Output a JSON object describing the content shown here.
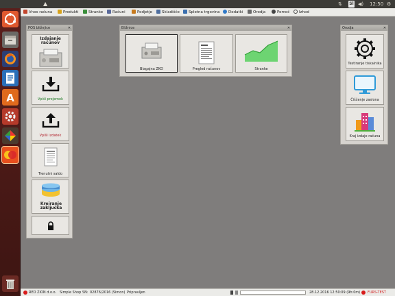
{
  "top_panel": {
    "keyboard_indicator": "Sl",
    "clock": "12:50"
  },
  "menu": [
    {
      "label": "Vnos računa",
      "icon": "receipt-icon",
      "color": "#c2452d"
    },
    {
      "label": "Produkti",
      "icon": "product-icon",
      "color": "#d7a21a"
    },
    {
      "label": "Stranke",
      "icon": "customers-icon",
      "color": "#3a8e3a"
    },
    {
      "label": "Računi",
      "icon": "invoices-icon",
      "color": "#5a6a9a"
    },
    {
      "label": "Podjetje",
      "icon": "company-icon",
      "color": "#c77a1d"
    },
    {
      "label": "Skladišče",
      "icon": "warehouse-icon",
      "color": "#4f6f9f"
    },
    {
      "label": "Spletna trgovina",
      "icon": "cart-icon",
      "color": "#3a6fae"
    },
    {
      "label": "Dodatki",
      "icon": "addons-icon",
      "color": "#2f79c8"
    },
    {
      "label": "Orodja",
      "icon": "tools-icon",
      "color": "#6a6a6a"
    },
    {
      "label": "Pomoč",
      "icon": "help-icon",
      "color": "#444444"
    },
    {
      "label": "Izhod",
      "icon": "exit-icon",
      "color": "#444444"
    }
  ],
  "pos_panel": {
    "title": "POS bližnjice",
    "buttons": [
      {
        "label": "Izdajanje računov",
        "icon": "cash-register-icon",
        "style": "bold"
      },
      {
        "label": "Vpiši prejemek",
        "icon": "download-tray-icon",
        "style": "grn"
      },
      {
        "label": "Vpiši izdatek",
        "icon": "upload-tray-icon",
        "style": "red"
      },
      {
        "label": "Trenutni saldo",
        "icon": "document-icon",
        "style": ""
      },
      {
        "label": "Kreiranje zaključka",
        "icon": "database-icon",
        "style": "bold"
      },
      {
        "label": "",
        "icon": "lock-icon",
        "style": ""
      }
    ]
  },
  "shortcuts_panel": {
    "title": "Bližnice",
    "buttons": [
      {
        "label": "Blagajna ZKD",
        "icon": "register-icon"
      },
      {
        "label": "Pregled računov",
        "icon": "invoice-list-icon"
      },
      {
        "label": "Stranke",
        "icon": "chart-area-icon"
      }
    ]
  },
  "tools_panel": {
    "title": "Orodja",
    "buttons": [
      {
        "label": "Testiranje tiskalnika",
        "icon": "gear-icon"
      },
      {
        "label": "Čiščenje zaslona",
        "icon": "monitor-icon"
      },
      {
        "label": "Kraj izdaje računa",
        "icon": "buildings-icon"
      }
    ]
  },
  "status": {
    "company": "RED ZION d.o.o.",
    "shop": "Simple Shop",
    "sn_label": "SN:",
    "sn": "02876/2016 (Simon)",
    "state": "Pripravljen",
    "datetime": "28.12.2016 12:50:09 (9h:0m)",
    "mode": "FURS-TEST",
    "mode_color": "#d21c1c"
  }
}
